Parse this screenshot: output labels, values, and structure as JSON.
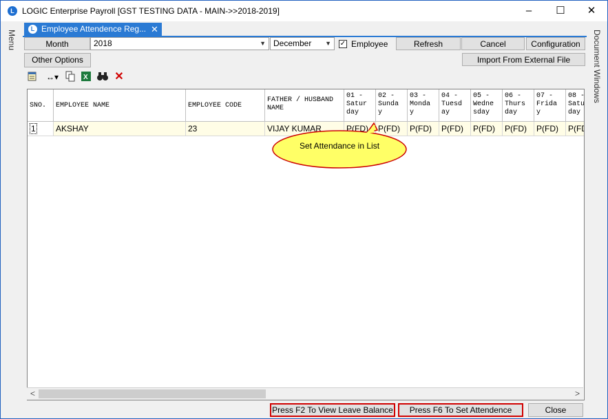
{
  "window": {
    "title": "LOGIC Enterprise Payroll  [GST TESTING DATA - MAIN->>2018-2019]",
    "minimize": "–",
    "maximize": "☐",
    "close": "✕"
  },
  "side_left": {
    "label": "Menu"
  },
  "side_right": {
    "label": "Document Windows"
  },
  "tab": {
    "label": "Employee Attendence Reg...",
    "close": "✕"
  },
  "filters": {
    "month_label": "Month",
    "year_value": "2018",
    "month_value": "December",
    "employee_checked": true,
    "employee_label": "Employee",
    "refresh": "Refresh",
    "cancel": "Cancel",
    "configuration": "Configuration",
    "other_options": "Other Options",
    "import": "Import From External File"
  },
  "toolbar": {
    "icons": [
      "notepad-icon",
      "column-resize-icon",
      "copy-icon",
      "excel-icon",
      "binoculars-icon",
      "delete-icon"
    ]
  },
  "grid": {
    "headers": {
      "sno": "SNO.",
      "name": "EMPLOYEE NAME",
      "code": "EMPLOYEE CODE",
      "father": "FATHER / HUSBAND NAME",
      "days": [
        "01 - Satur day",
        "02 - Sunda y",
        "03 - Monda y",
        "04 - Tuesd ay",
        "05 - Wedne sday",
        "06 - Thurs day",
        "07 - Frida y",
        "08 - Satu day"
      ]
    },
    "rows": [
      {
        "sno": "1",
        "name": "AKSHAY",
        "code": "23",
        "father": "VIJAY KUMAR",
        "days": [
          "P(FD)",
          "P(FD)",
          "P(FD)",
          "P(FD)",
          "P(FD)",
          "P(FD)",
          "P(FD)",
          "P(FD"
        ]
      }
    ]
  },
  "callout": {
    "text": "Set Attendance in List"
  },
  "scroll": {
    "left": "<",
    "right": ">"
  },
  "bottom": {
    "f2": "Press F2 To View Leave Balance",
    "f6": "Press F6 To Set Attendence",
    "close": "Close"
  }
}
